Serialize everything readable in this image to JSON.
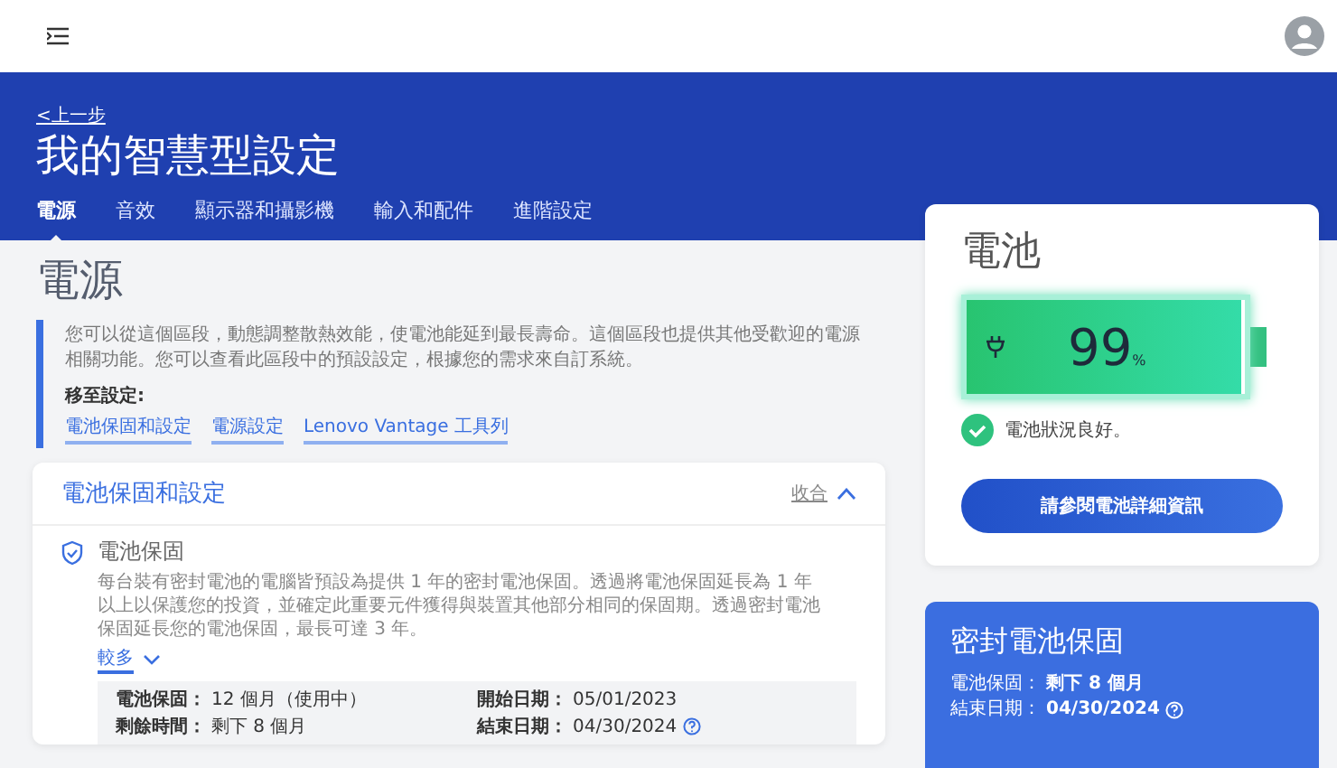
{
  "header": {
    "back_link": "<上一步",
    "title": "我的智慧型設定"
  },
  "tabs": [
    {
      "label": "電源",
      "selected": true
    },
    {
      "label": "音效",
      "selected": false
    },
    {
      "label": "顯示器和攝影機",
      "selected": false
    },
    {
      "label": "輸入和配件",
      "selected": false
    },
    {
      "label": "進階設定",
      "selected": false
    }
  ],
  "section": {
    "title": "電源",
    "description": "您可以從這個區段，動態調整散熱效能，使電池能延到最長壽命。這個區段也提供其他受歡迎的電源相關功能。您可以查看此區段中的預設設定，根據您的需求來自訂系統。",
    "jump_label": "移至設定:",
    "jump_links": [
      "電池保固和設定",
      "電源設定",
      "Lenovo Vantage 工具列"
    ]
  },
  "card": {
    "title": "電池保固和設定",
    "collapse": "收合",
    "item_title": "電池保固",
    "item_text": "每台裝有密封電池的電腦皆預設為提供 1 年的密封電池保固。透過將電池保固延長為 1 年以上以保護您的投資，並確定此重要元件獲得與裝置其他部分相同的保固期。透過密封電池保固延長您的電池保固，最長可達 3 年。",
    "more": "較多",
    "info": [
      {
        "label": "電池保固：",
        "value": "12 個月（使用中）"
      },
      {
        "label": "開始日期：",
        "value": "05/01/2023"
      },
      {
        "label": "剩餘時間：",
        "value": "剩下 8 個月"
      },
      {
        "label": "結束日期：",
        "value": "04/30/2024"
      }
    ]
  },
  "battery": {
    "title": "電池",
    "percent": "99",
    "unit": "%",
    "level": 0.99,
    "status": "電池狀況良好。",
    "button": "請參閱電池詳細資訊"
  },
  "warranty": {
    "title": "密封電池保固",
    "rows": [
      {
        "label": "電池保固：",
        "value": "剩下 8 個月"
      },
      {
        "label": "結束日期：",
        "value": "04/30/2024"
      }
    ]
  }
}
